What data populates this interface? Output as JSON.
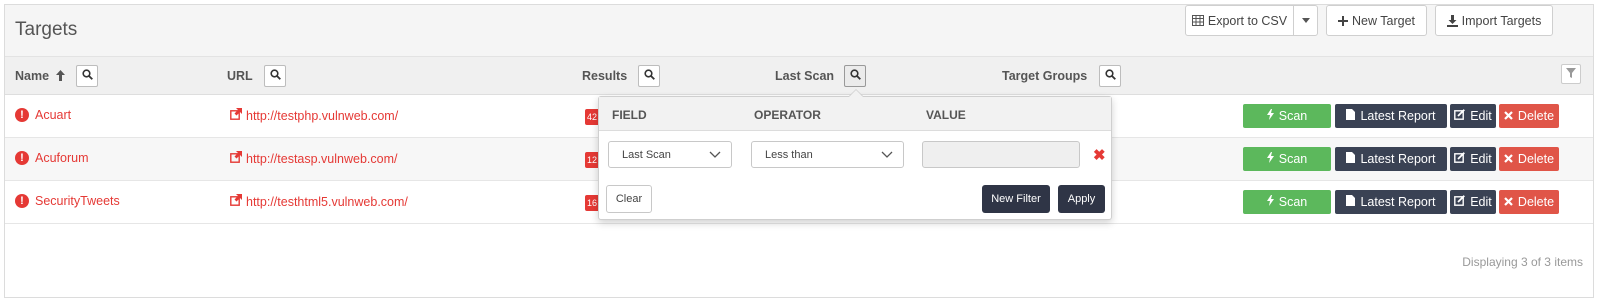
{
  "header": {
    "title": "Targets",
    "export_label": "Export to CSV",
    "new_target_label": "New Target",
    "import_label": "Import Targets"
  },
  "columns": {
    "name": "Name",
    "url": "URL",
    "results": "Results",
    "last_scan": "Last Scan",
    "target_groups": "Target Groups"
  },
  "rows": [
    {
      "name": "Acuart",
      "url": "http://testphp.vulnweb.com/",
      "results_badge": "42"
    },
    {
      "name": "Acuforum",
      "url": "http://testasp.vulnweb.com/",
      "results_badge": "12"
    },
    {
      "name": "SecurityTweets",
      "url": "http://testhtml5.vulnweb.com/",
      "results_badge": "16"
    }
  ],
  "actions": {
    "scan": "Scan",
    "latest_report": "Latest Report",
    "edit": "Edit",
    "delete": "Delete"
  },
  "filter_popup": {
    "field_header": "FIELD",
    "operator_header": "OPERATOR",
    "value_header": "VALUE",
    "field_value": "Last Scan",
    "operator_value": "Less than",
    "value": "",
    "clear_label": "Clear",
    "new_filter_label": "New Filter",
    "apply_label": "Apply"
  },
  "footer": {
    "status": "Displaying 3 of 3 items"
  },
  "colors": {
    "danger": "#e53935",
    "success": "#5cb85c",
    "dark": "#3a4254",
    "delete": "#e05548"
  }
}
